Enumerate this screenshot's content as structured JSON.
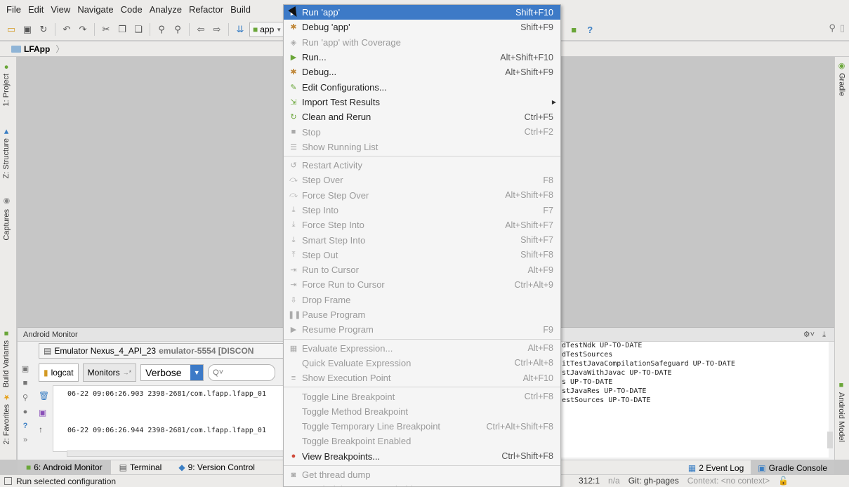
{
  "menubar": {
    "items": [
      "File",
      "Edit",
      "View",
      "Navigate",
      "Code",
      "Analyze",
      "Refactor",
      "Build"
    ],
    "active": "Run"
  },
  "toolbar": {
    "app_selector": "app",
    "help": "?"
  },
  "breadcrumb": {
    "project": "LFApp"
  },
  "left_tool_tabs": [
    "1: Project",
    "Z: Structure",
    "Captures",
    "Build Variants",
    "2: Favorites"
  ],
  "right_tool_tabs": [
    "Gradle",
    "Android Model"
  ],
  "monitor": {
    "title": "Android Monitor",
    "device": "Emulator Nexus_4_API_23",
    "device_id": "emulator-5554 [DISCON",
    "tab_logcat": "logcat",
    "tab_monitors": "Monitors",
    "log_level": "Verbose",
    "search_placeholder": "Q˅",
    "log_lines": [
      "06-22 09:06:26.903 2398-2681/com.lfapp.lfapp_01",
      "06-22 09:06:26.944 2398-2681/com.lfapp.lfapp_01"
    ]
  },
  "gradle_output": [
    "dTestNdk UP-TO-DATE",
    "dTestSources",
    "itTestJavaCompilationSafeguard UP-TO-DATE",
    "stJavaWithJavac UP-TO-DATE",
    "s UP-TO-DATE",
    "stJavaRes UP-TO-DATE",
    "estSources UP-TO-DATE"
  ],
  "bottom_tabs": {
    "android_monitor": "6: Android Monitor",
    "terminal": "Terminal",
    "version_control": "9: Version Control",
    "event_log": "2 Event Log",
    "gradle_console": "Gradle Console"
  },
  "status": {
    "message": "Run selected configuration",
    "position": "312:1",
    "na": "n/a",
    "git": "Git: gh-pages",
    "context": "Context: <no context>"
  },
  "run_menu": [
    {
      "label": "Run 'app'",
      "shortcut": "Shift+F10",
      "state": "highlighted",
      "icon": "play-icon"
    },
    {
      "label": "Debug 'app'",
      "shortcut": "Shift+F9",
      "state": "enabled",
      "icon": "bug-icon"
    },
    {
      "label": "Run 'app' with Coverage",
      "shortcut": "",
      "state": "disabled",
      "icon": "coverage-icon"
    },
    {
      "label": "Run...",
      "shortcut": "Alt+Shift+F10",
      "state": "enabled",
      "icon": "play-icon"
    },
    {
      "label": "Debug...",
      "shortcut": "Alt+Shift+F9",
      "state": "enabled",
      "icon": "bug-icon"
    },
    {
      "label": "Edit Configurations...",
      "shortcut": "",
      "state": "enabled",
      "icon": "edit-config-icon"
    },
    {
      "label": "Import Test Results",
      "shortcut": "",
      "state": "enabled",
      "icon": "import-icon",
      "submenu": true
    },
    {
      "label": "Clean and Rerun",
      "shortcut": "Ctrl+F5",
      "state": "enabled",
      "icon": "rerun-icon"
    },
    {
      "label": "Stop",
      "shortcut": "Ctrl+F2",
      "state": "disabled",
      "icon": "stop-icon"
    },
    {
      "label": "Show Running List",
      "shortcut": "",
      "state": "disabled",
      "icon": "list-icon",
      "sep_after": true
    },
    {
      "label": "Restart Activity",
      "shortcut": "",
      "state": "disabled",
      "icon": "restart-icon"
    },
    {
      "label": "Step Over",
      "shortcut": "F8",
      "state": "disabled",
      "icon": "step-over-icon"
    },
    {
      "label": "Force Step Over",
      "shortcut": "Alt+Shift+F8",
      "state": "disabled",
      "icon": "step-over-icon"
    },
    {
      "label": "Step Into",
      "shortcut": "F7",
      "state": "disabled",
      "icon": "step-into-icon"
    },
    {
      "label": "Force Step Into",
      "shortcut": "Alt+Shift+F7",
      "state": "disabled",
      "icon": "step-into-icon"
    },
    {
      "label": "Smart Step Into",
      "shortcut": "Shift+F7",
      "state": "disabled",
      "icon": "step-into-icon"
    },
    {
      "label": "Step Out",
      "shortcut": "Shift+F8",
      "state": "disabled",
      "icon": "step-out-icon"
    },
    {
      "label": "Run to Cursor",
      "shortcut": "Alt+F9",
      "state": "disabled",
      "icon": "cursor-icon"
    },
    {
      "label": "Force Run to Cursor",
      "shortcut": "Ctrl+Alt+9",
      "state": "disabled",
      "icon": "cursor-icon"
    },
    {
      "label": "Drop Frame",
      "shortcut": "",
      "state": "disabled",
      "icon": "drop-frame-icon"
    },
    {
      "label": "Pause Program",
      "shortcut": "",
      "state": "disabled",
      "icon": "pause-icon"
    },
    {
      "label": "Resume Program",
      "shortcut": "F9",
      "state": "disabled",
      "icon": "resume-icon",
      "sep_after": true
    },
    {
      "label": "Evaluate Expression...",
      "shortcut": "Alt+F8",
      "state": "disabled",
      "icon": "calculator-icon"
    },
    {
      "label": "Quick Evaluate Expression",
      "shortcut": "Ctrl+Alt+8",
      "state": "disabled",
      "icon": ""
    },
    {
      "label": "Show Execution Point",
      "shortcut": "Alt+F10",
      "state": "disabled",
      "icon": "execution-point-icon",
      "sep_after": true
    },
    {
      "label": "Toggle Line Breakpoint",
      "shortcut": "Ctrl+F8",
      "state": "disabled",
      "icon": ""
    },
    {
      "label": "Toggle Method Breakpoint",
      "shortcut": "",
      "state": "disabled",
      "icon": ""
    },
    {
      "label": "Toggle Temporary Line Breakpoint",
      "shortcut": "Ctrl+Alt+Shift+F8",
      "state": "disabled",
      "icon": ""
    },
    {
      "label": "Toggle Breakpoint Enabled",
      "shortcut": "",
      "state": "disabled",
      "icon": ""
    },
    {
      "label": "View Breakpoints...",
      "shortcut": "Ctrl+Shift+F8",
      "state": "enabled",
      "icon": "breakpoints-icon",
      "sep_after": true
    },
    {
      "label": "Get thread dump",
      "shortcut": "",
      "state": "disabled",
      "icon": "camera-icon"
    },
    {
      "label": "Attach debugger to Android process",
      "shortcut": "",
      "state": "disabled",
      "icon": "attach-icon"
    }
  ]
}
